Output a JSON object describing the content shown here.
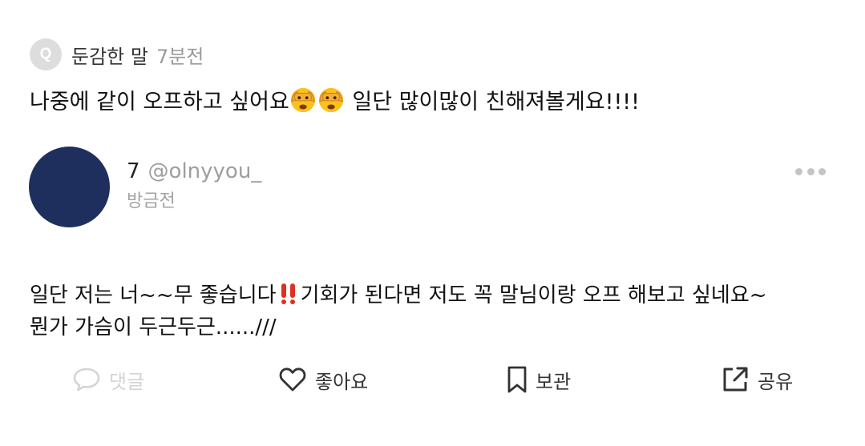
{
  "question": {
    "badge": "Q",
    "asker": "둔감한 말",
    "time": "7분전",
    "text_before_emoji": "나중에 같이 오프하고 싶어요",
    "emoji_icon": "face-with-peeking-eye",
    "emoji_count": 2,
    "text_after_emoji": " 일단 많이많이 친해져볼게요!!!!"
  },
  "answer": {
    "user_name": "7",
    "user_handle": "@olnyyou_",
    "time": "방금전",
    "avatar_color": "#1e2f5e",
    "body_part1": "일단 저는 너~~무 좋습니다",
    "body_icon": "double-exclamation-mark",
    "body_part2": "기회가 된다면 저도 꼭 말님이랑 오프 해보고 싶네요~",
    "body_line2": "뭔가 가슴이 두근두근....../// "
  },
  "actions": {
    "comment": "댓글",
    "like": "좋아요",
    "save": "보관",
    "share": "공유"
  }
}
